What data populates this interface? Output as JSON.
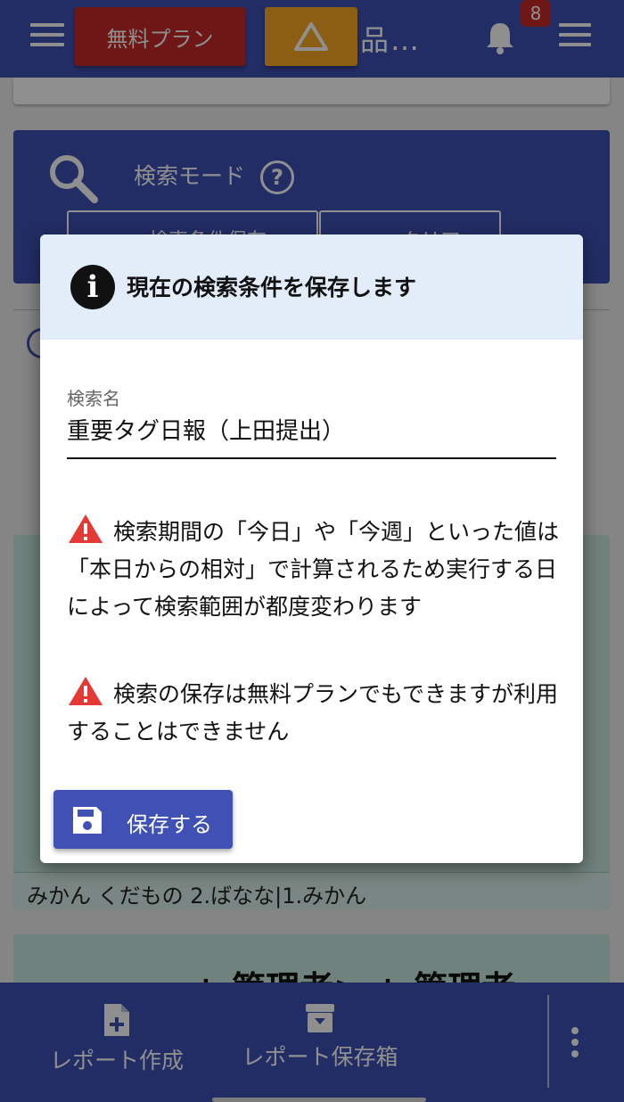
{
  "topbar": {
    "plan_button": "無料プラン",
    "title": "品…",
    "notification_count": "8"
  },
  "search_panel": {
    "mode_label": "検索モード",
    "help_glyph": "?",
    "save_conditions_button": "検索条件保存",
    "clear_button": "クリア"
  },
  "list": {
    "card1_footer": "みかん くだもの 2.ばなな|1.みかん",
    "card2_text": "+ 管理者> + 管理者"
  },
  "dialog": {
    "title": "現在の検索条件を保存します",
    "field_label": "検索名",
    "field_value": "重要タグ日報（上田提出）",
    "warning_1": "検索期間の「今日」や「今週」といった値は「本日からの相対」で計算されるため実行する日によって検索範囲が都度変わります",
    "warning_2": "検索の保存は無料プランでもできますが利用することはできません",
    "save_button": "保存する"
  },
  "bottom_nav": {
    "create_report": "レポート作成",
    "report_storage": "レポート保存箱"
  },
  "colors": {
    "primary": "#3f51b5",
    "plan_red": "#c62828",
    "warning_amber": "#f9a825",
    "warning_red": "#e53935",
    "dialog_header": "#e3ecf9"
  }
}
